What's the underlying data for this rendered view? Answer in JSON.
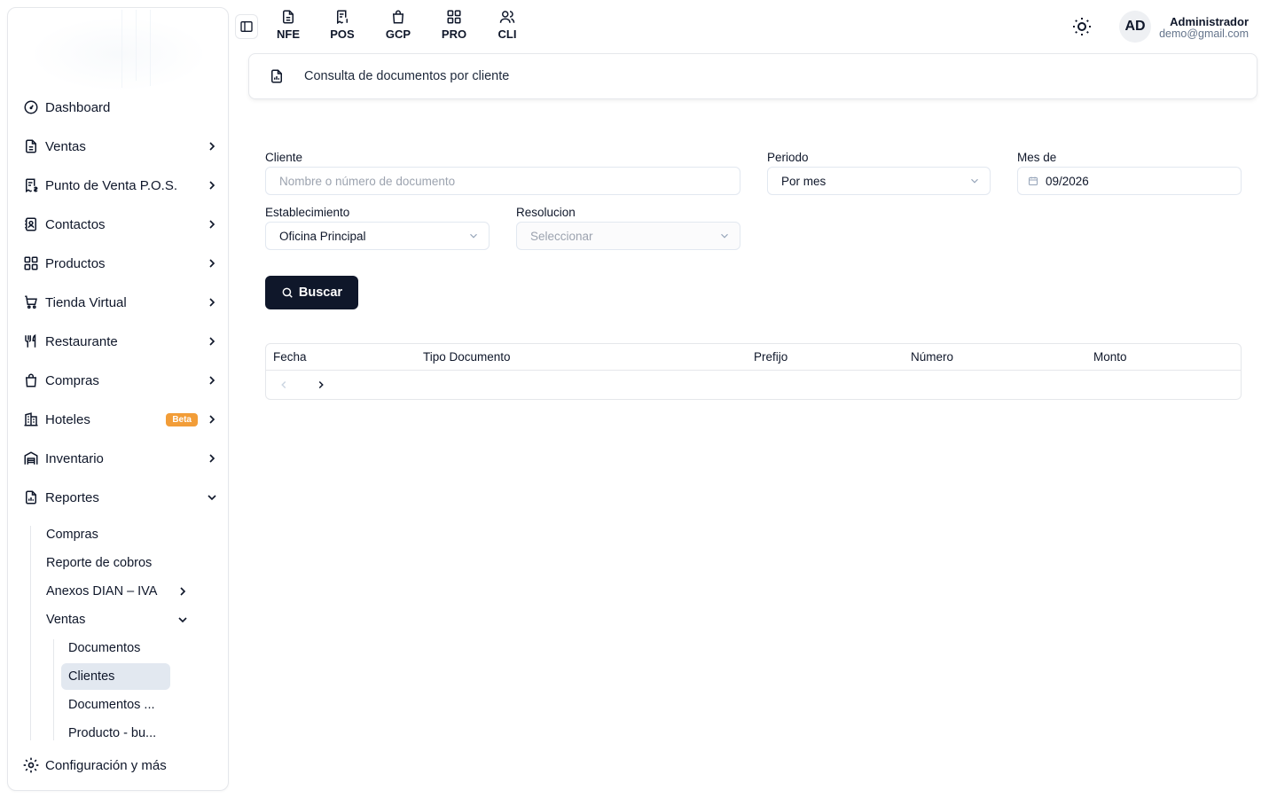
{
  "sidebar": {
    "items": [
      {
        "label": "Dashboard",
        "icon": "gauge-icon"
      },
      {
        "label": "Ventas",
        "icon": "document-icon"
      },
      {
        "label": "Punto de Venta P.O.S.",
        "icon": "receipt-dollar-icon"
      },
      {
        "label": "Contactos",
        "icon": "contact-book-icon"
      },
      {
        "label": "Productos",
        "icon": "grid-icon"
      },
      {
        "label": "Tienda Virtual",
        "icon": "cart-icon"
      },
      {
        "label": "Restaurante",
        "icon": "utensils-icon"
      },
      {
        "label": "Compras",
        "icon": "shopping-bag-icon"
      },
      {
        "label": "Hoteles",
        "icon": "hotel-icon",
        "badge": "Beta"
      },
      {
        "label": "Inventario",
        "icon": "warehouse-icon"
      },
      {
        "label": "Reportes",
        "icon": "report-icon"
      }
    ],
    "reportes_sub": {
      "compras": "Compras",
      "cobros": "Reporte de cobros",
      "anexos": "Anexos DIAN – IVA",
      "ventas": "Ventas",
      "ventas_sub": {
        "documentos": "Documentos",
        "clientes": "Clientes",
        "documentos2": "Documentos ...",
        "producto": "Producto - bu..."
      }
    },
    "config": "Configuración y más"
  },
  "topbar": {
    "modules": [
      "NFE",
      "POS",
      "GCP",
      "PRO",
      "CLI"
    ],
    "user": {
      "initials": "AD",
      "name": "Administrador",
      "email": "demo@gmail.com"
    }
  },
  "page": {
    "title": "Consulta de documentos por cliente"
  },
  "form": {
    "cliente_label": "Cliente",
    "cliente_placeholder": "Nombre o número de documento",
    "periodo_label": "Periodo",
    "periodo_value": "Por mes",
    "mes_label": "Mes de",
    "mes_value": "09/2026",
    "establecimiento_label": "Establecimiento",
    "establecimiento_value": "Oficina Principal",
    "resolucion_label": "Resolucion",
    "resolucion_placeholder": "Seleccionar",
    "buscar_label": "Buscar"
  },
  "table": {
    "columns": [
      "Fecha",
      "Tipo Documento",
      "Prefijo",
      "Número",
      "Monto"
    ]
  }
}
